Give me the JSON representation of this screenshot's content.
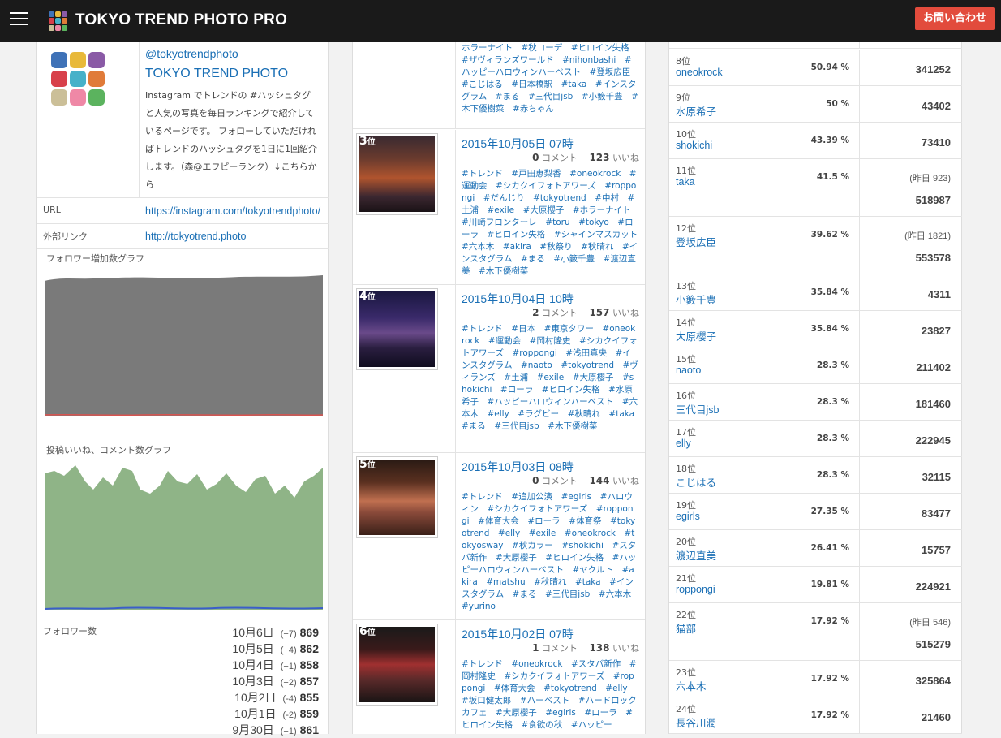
{
  "header": {
    "brand": "TOKYO TREND PHOTO PRO",
    "contact_label": "お問い合わせ"
  },
  "profile": {
    "handle": "@tokyotrendphoto",
    "name": "TOKYO TREND PHOTO",
    "description": "Instagram でトレンドの #ハッシュタグ と人気の写真を毎日ランキングで紹介しているページです。 フォローしていただければトレンドのハッシュタグを1日に1回紹介します。（森@エフピーランク）↓こちらから",
    "url_label": "URL",
    "url_value": "https://instagram.com/tokyotrendphoto/",
    "ext_label": "外部リンク",
    "ext_value": "http://tokyotrend.photo",
    "follower_graph_title": "フォロワー増加数グラフ",
    "likes_graph_title": "投稿いいね、コメント数グラフ",
    "followers_label": "フォロワー数",
    "followers": [
      {
        "date": "10月6日",
        "change": "(+7)",
        "count": "869"
      },
      {
        "date": "10月5日",
        "change": "(+4)",
        "count": "862"
      },
      {
        "date": "10月4日",
        "change": "(+1)",
        "count": "858"
      },
      {
        "date": "10月3日",
        "change": "(+2)",
        "count": "857"
      },
      {
        "date": "10月2日",
        "change": "(-4)",
        "count": "855"
      },
      {
        "date": "10月1日",
        "change": "(-2)",
        "count": "859"
      },
      {
        "date": "9月30日",
        "change": "(+1)",
        "count": "861"
      }
    ],
    "colors": {
      "follower_area": "#7a7a7a",
      "follower_line": "#d9534f",
      "likes_area": "#8fb487",
      "comments_line": "#3a5ec9"
    }
  },
  "posts": [
    {
      "rank": "",
      "rank_unit": "",
      "title": "",
      "comments": "",
      "likes": "",
      "tags": "ホラーナイト　#秋コーデ　#ヒロイン失格　#ザヴィランズワールド　#nihonbashi　#ハッピーハロウィンハーベスト　#登坂広臣　#こじはる　#日本橋駅　#taka　#インスタグラム　#まる　#三代目jsb　#小籔千豊　#木下優樹菜　#赤ちゃん"
    },
    {
      "rank": "3",
      "rank_unit": "位",
      "title": "2015年10月05日 07時",
      "comments": "0",
      "likes": "123",
      "tags": "#トレンド　#戸田恵梨香　#oneokrock　#運動会　#シカクイフォトアワーズ　#roppongi　#だんじり　#tokyotrend　#中村　#土浦　#exile　#大原櫻子　#ホラーナイト　#川崎フロンターレ　#toru　#tokyo　#ローラ　#ヒロイン失格　#シャインマスカット　#六本木　#akira　#秋祭り　#秋晴れ　#インスタグラム　#まる　#小籔千豊　#渡辺直美　#木下優樹菜"
    },
    {
      "rank": "4",
      "rank_unit": "位",
      "title": "2015年10月04日 10時",
      "comments": "2",
      "likes": "157",
      "tags": "#トレンド　#日本　#東京タワー　#oneokrock　#運動会　#岡村隆史　#シカクイフォトアワーズ　#roppongi　#浅田真央　#インスタグラム　#naoto　#tokyotrend　#ヴィランズ　#土浦　#exile　#大原櫻子　#shokichi　#ローラ　#ヒロイン失格　#水原希子　#ハッピーハロウィンハーベスト　#六本木　#elly　#ラグビー　#秋晴れ　#taka　#まる　#三代目jsb　#木下優樹菜"
    },
    {
      "rank": "5",
      "rank_unit": "位",
      "title": "2015年10月03日 08時",
      "comments": "0",
      "likes": "144",
      "tags": "#トレンド　#追加公演　#egirls　#ハロウィン　#シカクイフォトアワーズ　#roppongi　#体育大会　#ローラ　#体育祭　#tokyotrend　#elly　#exile　#oneokrock　#tokyosway　#秋カラー　#shokichi　#スタバ新作　#大原櫻子　#ヒロイン失格　#ハッピーハロウィンハーベスト　#ヤクルト　#akira　#matshu　#秋晴れ　#taka　#インスタグラム　#まる　#三代目jsb　#六本木　#yurino"
    },
    {
      "rank": "6",
      "rank_unit": "位",
      "title": "2015年10月02日 07時",
      "comments": "1",
      "likes": "138",
      "tags": "#トレンド　#oneokrock　#スタバ新作　#岡村隆史　#シカクイフォトアワーズ　#roppongi　#体育大会　#tokyotrend　#elly　#坂口健太郎　#ハーベスト　#ハードロックカフェ　#大原櫻子　#egirls　#ローラ　#ヒロイン失格　#食欲の秋　#ハッピー"
    }
  ],
  "post_labels": {
    "comment_unit": "コメント",
    "like_unit": "いいね"
  },
  "ranking": [
    {
      "pos": "",
      "name": "",
      "pct": "",
      "prev": "",
      "total": ""
    },
    {
      "pos": "8位",
      "name": "oneokrock",
      "pct": "50.94 %",
      "prev": "",
      "total": "341252"
    },
    {
      "pos": "9位",
      "name": "水原希子",
      "pct": "50 %",
      "prev": "",
      "total": "43402"
    },
    {
      "pos": "10位",
      "name": "shokichi",
      "pct": "43.39 %",
      "prev": "",
      "total": "73410"
    },
    {
      "pos": "11位",
      "name": "taka",
      "pct": "41.5 %",
      "prev": "(昨日 923)",
      "total": "518987"
    },
    {
      "pos": "12位",
      "name": "登坂広臣",
      "pct": "39.62 %",
      "prev": "(昨日 1821)",
      "total": "553578"
    },
    {
      "pos": "13位",
      "name": "小籔千豊",
      "pct": "35.84 %",
      "prev": "",
      "total": "4311"
    },
    {
      "pos": "14位",
      "name": "大原櫻子",
      "pct": "35.84 %",
      "prev": "",
      "total": "23827"
    },
    {
      "pos": "15位",
      "name": "naoto",
      "pct": "28.3 %",
      "prev": "",
      "total": "211402"
    },
    {
      "pos": "16位",
      "name": "三代目jsb",
      "pct": "28.3 %",
      "prev": "",
      "total": "181460"
    },
    {
      "pos": "17位",
      "name": "elly",
      "pct": "28.3 %",
      "prev": "",
      "total": "222945"
    },
    {
      "pos": "18位",
      "name": "こじはる",
      "pct": "28.3 %",
      "prev": "",
      "total": "32115"
    },
    {
      "pos": "19位",
      "name": "egirls",
      "pct": "27.35 %",
      "prev": "",
      "total": "83477"
    },
    {
      "pos": "20位",
      "name": "渡辺直美",
      "pct": "26.41 %",
      "prev": "",
      "total": "15757"
    },
    {
      "pos": "21位",
      "name": "roppongi",
      "pct": "19.81 %",
      "prev": "",
      "total": "224921"
    },
    {
      "pos": "22位",
      "name": "猫部",
      "pct": "17.92 %",
      "prev": "(昨日 546)",
      "total": "515279"
    },
    {
      "pos": "23位",
      "name": "六本木",
      "pct": "17.92 %",
      "prev": "",
      "total": "325864"
    },
    {
      "pos": "24位",
      "name": "長谷川潤",
      "pct": "17.92 %",
      "prev": "",
      "total": "21460"
    }
  ]
}
